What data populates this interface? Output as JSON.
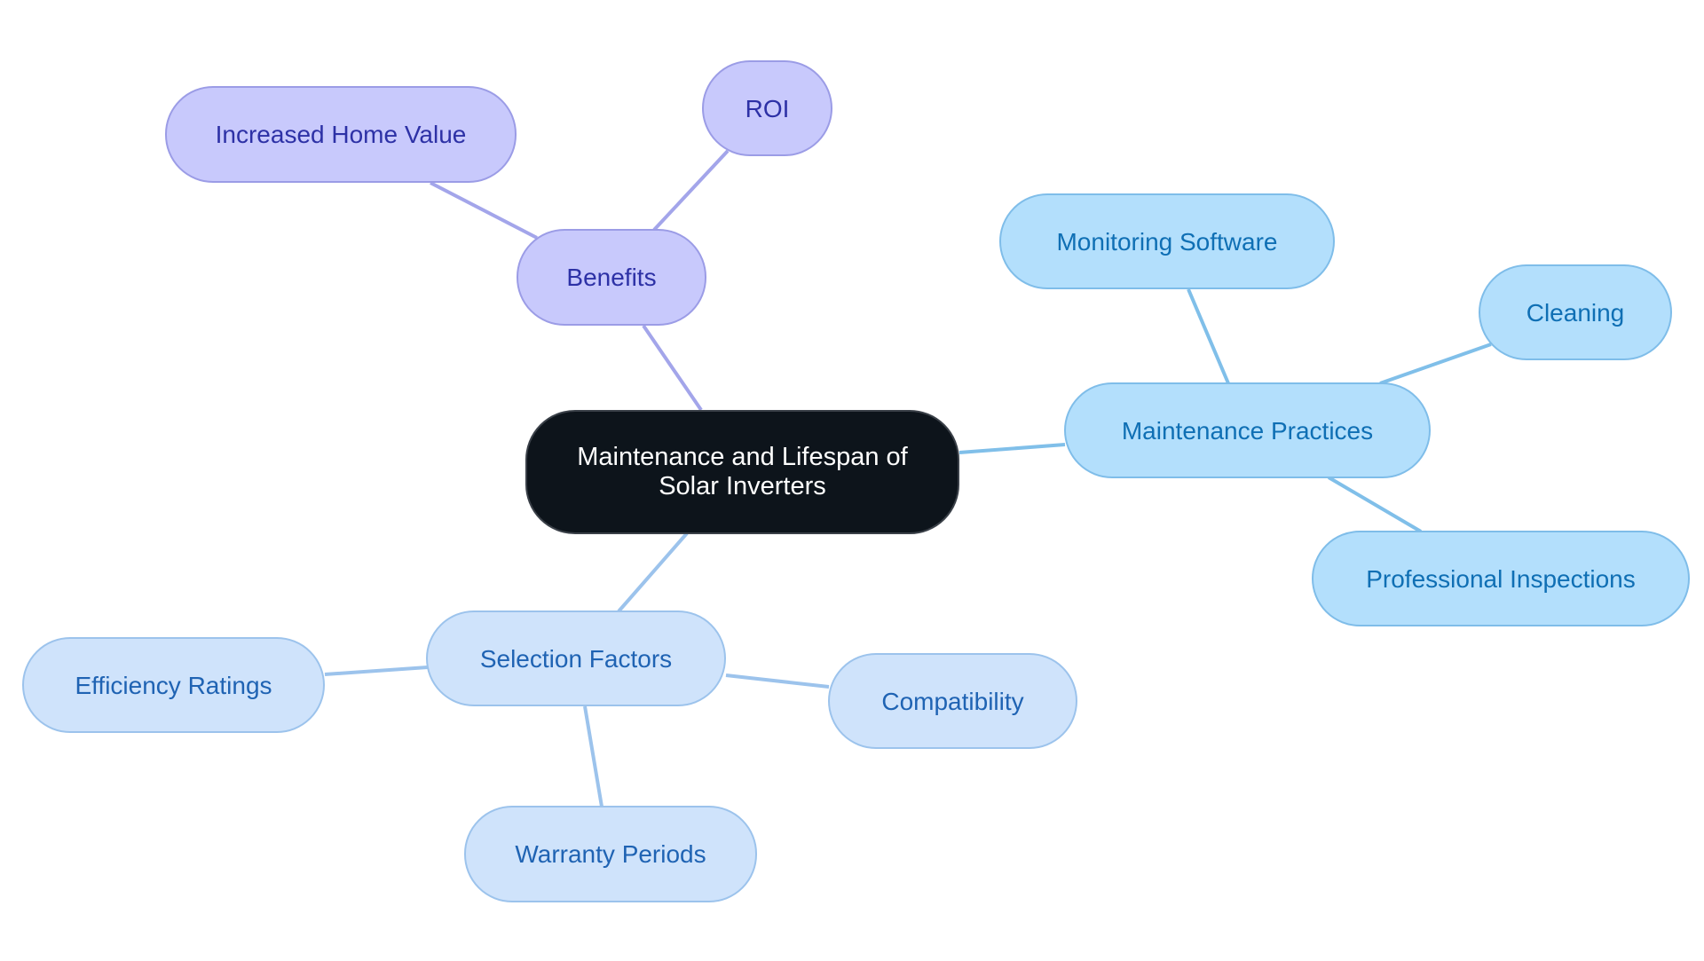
{
  "diagram": {
    "type": "mindmap",
    "colors": {
      "root_bg": "#0d141b",
      "benefits_branch": "#c8c9fc",
      "benefits_edge": "#a3a5ea",
      "maintenance_branch": "#b3dffc",
      "maintenance_edge": "#80bfe9",
      "selection_branch": "#cfe3fb",
      "selection_edge": "#9cc3ec"
    },
    "root": {
      "label": "Maintenance and Lifespan of Solar Inverters"
    },
    "branches": [
      {
        "label": "Benefits",
        "children": [
          {
            "label": "Increased Home Value"
          },
          {
            "label": "ROI"
          }
        ]
      },
      {
        "label": "Maintenance Practices",
        "children": [
          {
            "label": "Monitoring Software"
          },
          {
            "label": "Cleaning"
          },
          {
            "label": "Professional Inspections"
          }
        ]
      },
      {
        "label": "Selection Factors",
        "children": [
          {
            "label": "Efficiency Ratings"
          },
          {
            "label": "Compatibility"
          },
          {
            "label": "Warranty Periods"
          }
        ]
      }
    ]
  }
}
